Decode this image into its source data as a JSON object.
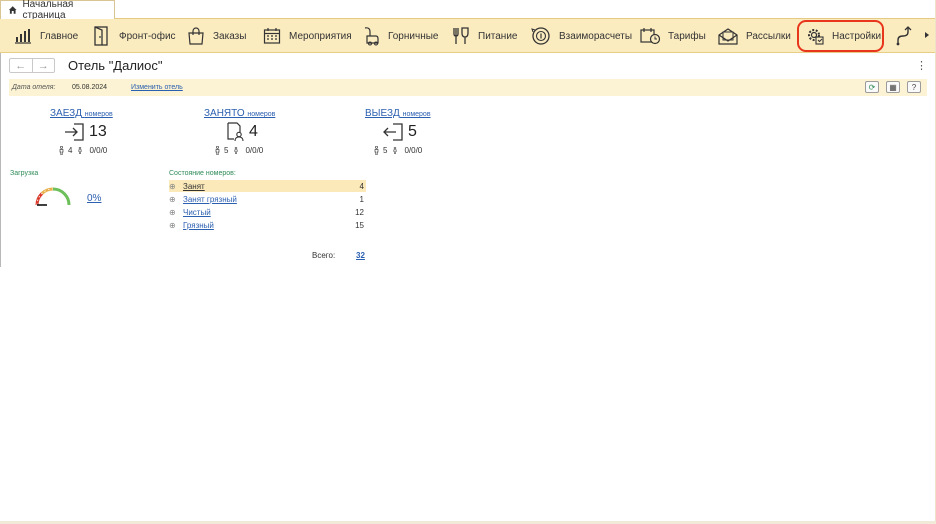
{
  "tab": {
    "label": "Начальная страница"
  },
  "sections": [
    {
      "label": "Главное",
      "icon": "bar-chart-icon"
    },
    {
      "label": "Фронт-офис",
      "icon": "door-icon"
    },
    {
      "label": "Заказы",
      "icon": "shopping-bag-icon"
    },
    {
      "label": "Мероприятия",
      "icon": "calendar-icon"
    },
    {
      "label": "Горничные",
      "icon": "vacuum-cleaner-icon"
    },
    {
      "label": "Питание",
      "icon": "food-icon"
    },
    {
      "label": "Взаиморасчеты",
      "icon": "settlement-icon"
    },
    {
      "label": "Тарифы",
      "icon": "tariff-icon"
    },
    {
      "label": "Рассылки",
      "icon": "mailing-icon"
    },
    {
      "label": "Настройки",
      "icon": "settings-gear-icon"
    }
  ],
  "header": {
    "title": "Отель \"Далиос\"",
    "back": "←",
    "forward": "→",
    "menu": "⋮"
  },
  "infobar": {
    "date_label": "Дата отеля:",
    "date_value": "05.08.2024",
    "change_link": "Изменить отель",
    "refresh": "⟳",
    "calendar": "▦",
    "help": "?"
  },
  "stats": [
    {
      "head": "ЗАЕЗД",
      "sub": "номеров",
      "value": "13",
      "adults": "4",
      "children": "0/0/0"
    },
    {
      "head": "ЗАНЯТО",
      "sub": "номеров",
      "value": "4",
      "adults": "5",
      "children": "0/0/0"
    },
    {
      "head": "ВЫЕЗД",
      "sub": "номеров",
      "value": "5",
      "adults": "5",
      "children": "0/0/0"
    }
  ],
  "load": {
    "label": "Загрузка",
    "percent": "0%"
  },
  "room_status": {
    "label": "Состояние номеров:",
    "rows": [
      {
        "name": "Занят",
        "count": "4"
      },
      {
        "name": "Занят грязный",
        "count": "1"
      },
      {
        "name": "Чистый",
        "count": "12"
      },
      {
        "name": "Грязный",
        "count": "15"
      }
    ],
    "total_label": "Всего:",
    "total": "32"
  },
  "colors": {
    "accent_bar": "#fbecc0",
    "highlight": "#e8361c",
    "link": "#2b5fb0",
    "green": "#2e8b57"
  }
}
